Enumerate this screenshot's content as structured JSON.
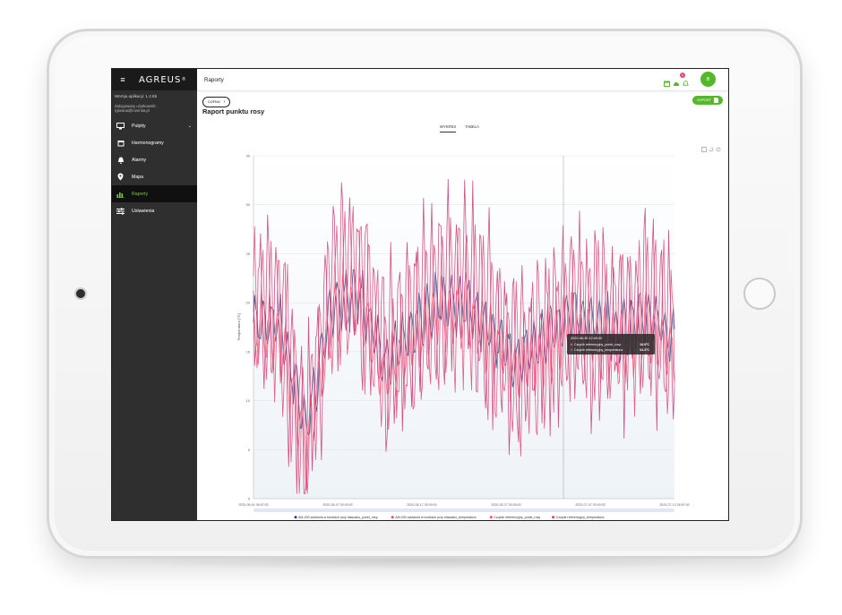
{
  "app": {
    "logo": "AGREUS",
    "version": "Wersja aplikacji: 1.2.85",
    "logged_in_label": "Zalogowany użytkownik:",
    "user_email": "rglowna@inventia.pl",
    "avatar_initial": "B",
    "notification_count": "2"
  },
  "sidebar": {
    "items": [
      {
        "label": "Pulpity",
        "icon": "monitor-icon",
        "has_chevron": true,
        "active": false
      },
      {
        "label": "Harmonogramy",
        "icon": "calendar-icon",
        "active": false
      },
      {
        "label": "Alarmy",
        "icon": "bell-icon",
        "active": false
      },
      {
        "label": "Mapa",
        "icon": "map-pin-icon",
        "active": false
      },
      {
        "label": "Raporty",
        "icon": "bar-chart-icon",
        "active": true
      },
      {
        "label": "Ustawienia",
        "icon": "sliders-icon",
        "active": false
      }
    ]
  },
  "header": {
    "title": "Raporty"
  },
  "page": {
    "back_label": "COFNIJ",
    "title": "Raport punktu rosy",
    "export_label": "EXPORT",
    "tabs": [
      {
        "label": "WYKRES",
        "active": true
      },
      {
        "label": "TABELA",
        "active": false
      }
    ]
  },
  "colors": {
    "accent": "#54b82a",
    "sidebar_bg": "#2f2f2f",
    "series_blue": "#2c3d7c",
    "series_red": "#ff4b6e",
    "series_magenta": "#d0407a",
    "series_pink": "#ff6b8a"
  },
  "chart_data": {
    "type": "line",
    "ylabel": "Temperatura [°C]",
    "ylim": [
      0,
      35
    ],
    "yticks": [
      "0",
      "5",
      "10",
      "15",
      "20",
      "25",
      "30",
      "35"
    ],
    "xticks": [
      "2020-06-01 06:57:00",
      "2020-06-07 00:00:00",
      "2020-06-17 00:00:00",
      "2020-06-27 00:00:00",
      "2020-07-07 00:00:00",
      "2020-07-13 06:57:00"
    ],
    "legend_position": "bottom",
    "series": [
      {
        "name": "AM-200 szklarnia w tunelach przy blaszaku_punkt_rosy",
        "color": "#2c3d7c",
        "baseline": [
          18,
          18,
          7,
          20,
          21,
          14,
          17,
          20,
          20,
          17,
          14,
          16,
          19,
          18,
          17,
          19,
          16
        ],
        "amp": 2.5
      },
      {
        "name": "AM-200 szklarnia w tunelach przy blaszaku_temperatura",
        "color": "#e0507a",
        "baseline": [
          19,
          18,
          6,
          21,
          22,
          13,
          16,
          20,
          21,
          17,
          13,
          15,
          19,
          17,
          17,
          18,
          16
        ],
        "amp": 7
      },
      {
        "name": "Czujnik referencyjny_punkt_rosy",
        "color": "#ff4b6e",
        "baseline": [
          17,
          17,
          5,
          19,
          20,
          12,
          16,
          19,
          19,
          16,
          13,
          15,
          18,
          16,
          16,
          17,
          15
        ],
        "amp": 3
      },
      {
        "name": "Czujnik referencyjny_temperatura",
        "color": "#c8407a",
        "baseline": [
          20,
          19,
          6,
          22,
          23,
          14,
          17,
          22,
          22,
          18,
          14,
          16,
          20,
          18,
          18,
          19,
          17
        ],
        "amp": 8
      }
    ],
    "tooltip": {
      "title": "2020-06-30 12:40:00",
      "rows": [
        {
          "label": "Czujnik referencyjny_punkt_rosy",
          "value": "18.9°C"
        },
        {
          "label": "Czujnik referencyjny_temperatura",
          "value": "24.4°C"
        }
      ]
    }
  }
}
